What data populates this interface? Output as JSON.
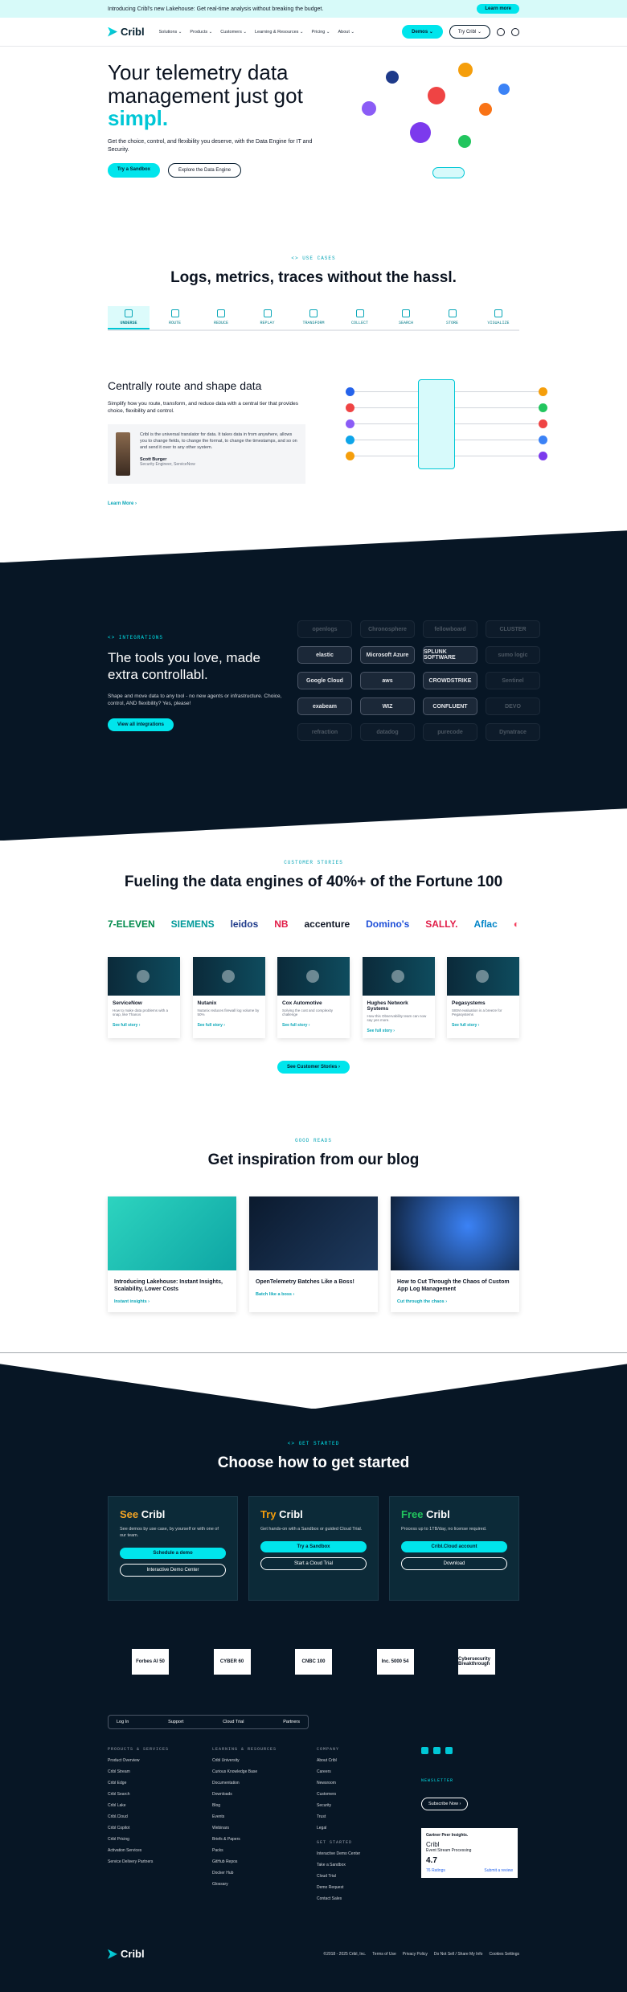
{
  "announcement": {
    "text": "Introducing Cribl's new Lakehouse: Get real-time analysis without breaking the budget.",
    "button": "Learn more"
  },
  "nav": {
    "logo": "Cribl",
    "links": [
      "Solutions ⌄",
      "Products ⌄",
      "Customers ⌄",
      "Learning & Resources ⌄",
      "Pricing ⌄",
      "About ⌄"
    ],
    "demo": "Demos ⌄",
    "try": "Try Cribl ⌄"
  },
  "hero": {
    "title": "Your telemetry data management just got",
    "accent": "simpl.",
    "desc": "Get the choice, control, and flexibility you deserve, with the Data Engine for IT and Security.",
    "cta_primary": "Try a Sandbox",
    "cta_secondary": "Explore the Data Engine"
  },
  "usecases": {
    "kicker": "<> USE CASES",
    "title": "Logs, metrics, traces without the hassl.",
    "tabs": [
      "UNDERSE",
      "ROUTE",
      "REDUCE",
      "REPLAY",
      "TRANSFORM",
      "COLLECT",
      "SEARCH",
      "STORE",
      "VISUALIZE"
    ]
  },
  "route": {
    "title": "Centrally route and shape data",
    "desc": "Simplify how you route, transform, and reduce data with a central tier that provides choice, flexibility and control.",
    "quote": "Cribl is the universal translator for data. It takes data in from anywhere, allows you to change fields, to change the format, to change the timestamps, and so on and send it over to any other system.",
    "name": "Scott Burger",
    "role": "Security Engineer, ServiceNow",
    "link": "Learn More  ›"
  },
  "integrations": {
    "kicker": "<> INTEGRATIONS",
    "title": "The tools you love, made extra controllabl.",
    "desc": "Shape and move data to any tool - no new agents or infrastructure. Choice, control, AND flexibility? Yes, please!",
    "button": "View all integrations",
    "logos": [
      "openlogs",
      "Chronosphere",
      "fellowboard",
      "CLUSTER",
      "elastic",
      "Microsoft Azure",
      "SPLUNK SOFTWARE",
      "sumo logic",
      "Google Cloud",
      "aws",
      "CROWDSTRIKE",
      "Sentinel",
      "exabeam",
      "WIZ",
      "CONFLUENT",
      "DEVO",
      "refraction",
      "datadog",
      "purecode",
      "Dynatrace"
    ]
  },
  "customers": {
    "kicker": "CUSTOMER STORIES",
    "title": "Fueling the data engines of 40%+ of the Fortune 100",
    "brands": [
      "7-ELEVEN",
      "SIEMENS",
      "leidos",
      "NB",
      "accenture",
      "Domino's",
      "SALLY.",
      "Aflac",
      "◐"
    ],
    "stories": [
      {
        "name": "ServiceNow",
        "desc": "How to make data problems with a snap, like Thanos",
        "link": "See full story  ›"
      },
      {
        "name": "Nutanix",
        "desc": "Nutanix reduces firewall log volume by 50%",
        "link": "See full story  ›"
      },
      {
        "name": "Cox Automotive",
        "desc": "Solving the cost and complexity challenge",
        "link": "See full story  ›"
      },
      {
        "name": "Hughes Network Systems",
        "desc": "How this Observability team can now say yes more.",
        "link": "See full story  ›"
      },
      {
        "name": "Pegasystems",
        "desc": "SIEM evaluation is a breeze for Pegasystems",
        "link": "See full story  ›"
      }
    ],
    "button": "See Customer Stories  ›"
  },
  "blog": {
    "kicker": "GOOD READS",
    "title": "Get inspiration from our blog",
    "posts": [
      {
        "title": "Introducing Lakehouse: Instant Insights, Scalability, Lower Costs",
        "link": "Instant insights  ›"
      },
      {
        "title": "OpenTelemetry Batches Like a Boss!",
        "link": "Batch like a boss  ›"
      },
      {
        "title": "How to Cut Through the Chaos of Custom App Log Management",
        "link": "Cut through the chaos  ›"
      }
    ]
  },
  "getstarted": {
    "kicker": "<> GET STARTED",
    "title": "Choose how to get started",
    "plans": [
      {
        "accent": "See",
        "name": "Cribl",
        "accent_color": "#f5a524",
        "desc": "See demos by use case, by yourself or with one of our team.",
        "primary": "Schedule a demo",
        "secondary": "Interactive Demo Center"
      },
      {
        "accent": "Try",
        "name": "Cribl",
        "accent_color": "#f59e0b",
        "desc": "Get hands-on with a Sandbox or guided Cloud Trial.",
        "primary": "Try a Sandbox",
        "secondary": "Start a Cloud Trial"
      },
      {
        "accent": "Free",
        "name": "Cribl",
        "accent_color": "#22c55e",
        "desc": "Process up to 1TB/day, no license required.",
        "primary": "Cribl.Cloud account",
        "secondary": "Download"
      }
    ]
  },
  "awards": [
    "Forbes AI 50",
    "CYBER 60",
    "CNBC 100",
    "Inc. 5000 54",
    "Cybersecurity Breakthrough"
  ],
  "footer": {
    "quicklinks": [
      "Log In",
      "Support",
      "Cloud Trial",
      "Partners"
    ],
    "columns": [
      {
        "heading": "PRODUCTS & SERVICES",
        "links": [
          "Product Overview",
          "Cribl Stream",
          "Cribl Edge",
          "Cribl Search",
          "Cribl Lake",
          "Cribl.Cloud",
          "Cribl Copilot",
          "Cribl Pricing",
          "Activation Services",
          "Service Delivery Partners"
        ]
      },
      {
        "heading": "LEARNING & RESOURCES",
        "links": [
          "Cribl University",
          "Curious Knowledge Base",
          "Documentation",
          "Downloads",
          "Blog",
          "Events",
          "Webinars",
          "Briefs & Papers",
          "Packs",
          "GitHub Repos",
          "Docker Hub",
          "Glossary"
        ]
      },
      {
        "heading": "COMPANY",
        "links": [
          "About Cribl",
          "Careers",
          "Newsroom",
          "Customers",
          "Security",
          "Trust",
          "Legal"
        ]
      },
      {
        "heading": "GET STARTED",
        "links": [
          "Interactive Demo Center",
          "Take a Sandbox",
          "Cloud Trial",
          "Demo Request",
          "Contact Sales"
        ]
      }
    ],
    "newsletter": "NEWSLETTER",
    "subscribe": "Subscribe Now  ›",
    "gartner": {
      "brand": "Gartner Peer Insights.",
      "product": "Cribl",
      "category": "Event Stream Processing",
      "rating": "4.7",
      "reviews": "76 Ratings",
      "review_link": "Submit a review"
    },
    "copyright": "©2018 - 2025 Cribl, Inc.",
    "legal": [
      "Terms of Use",
      "Privacy Policy",
      "Do Not Sell / Share My Info",
      "Cookies Settings"
    ]
  },
  "colors": {
    "accent": "#00e5ec",
    "dark": "#071625"
  }
}
